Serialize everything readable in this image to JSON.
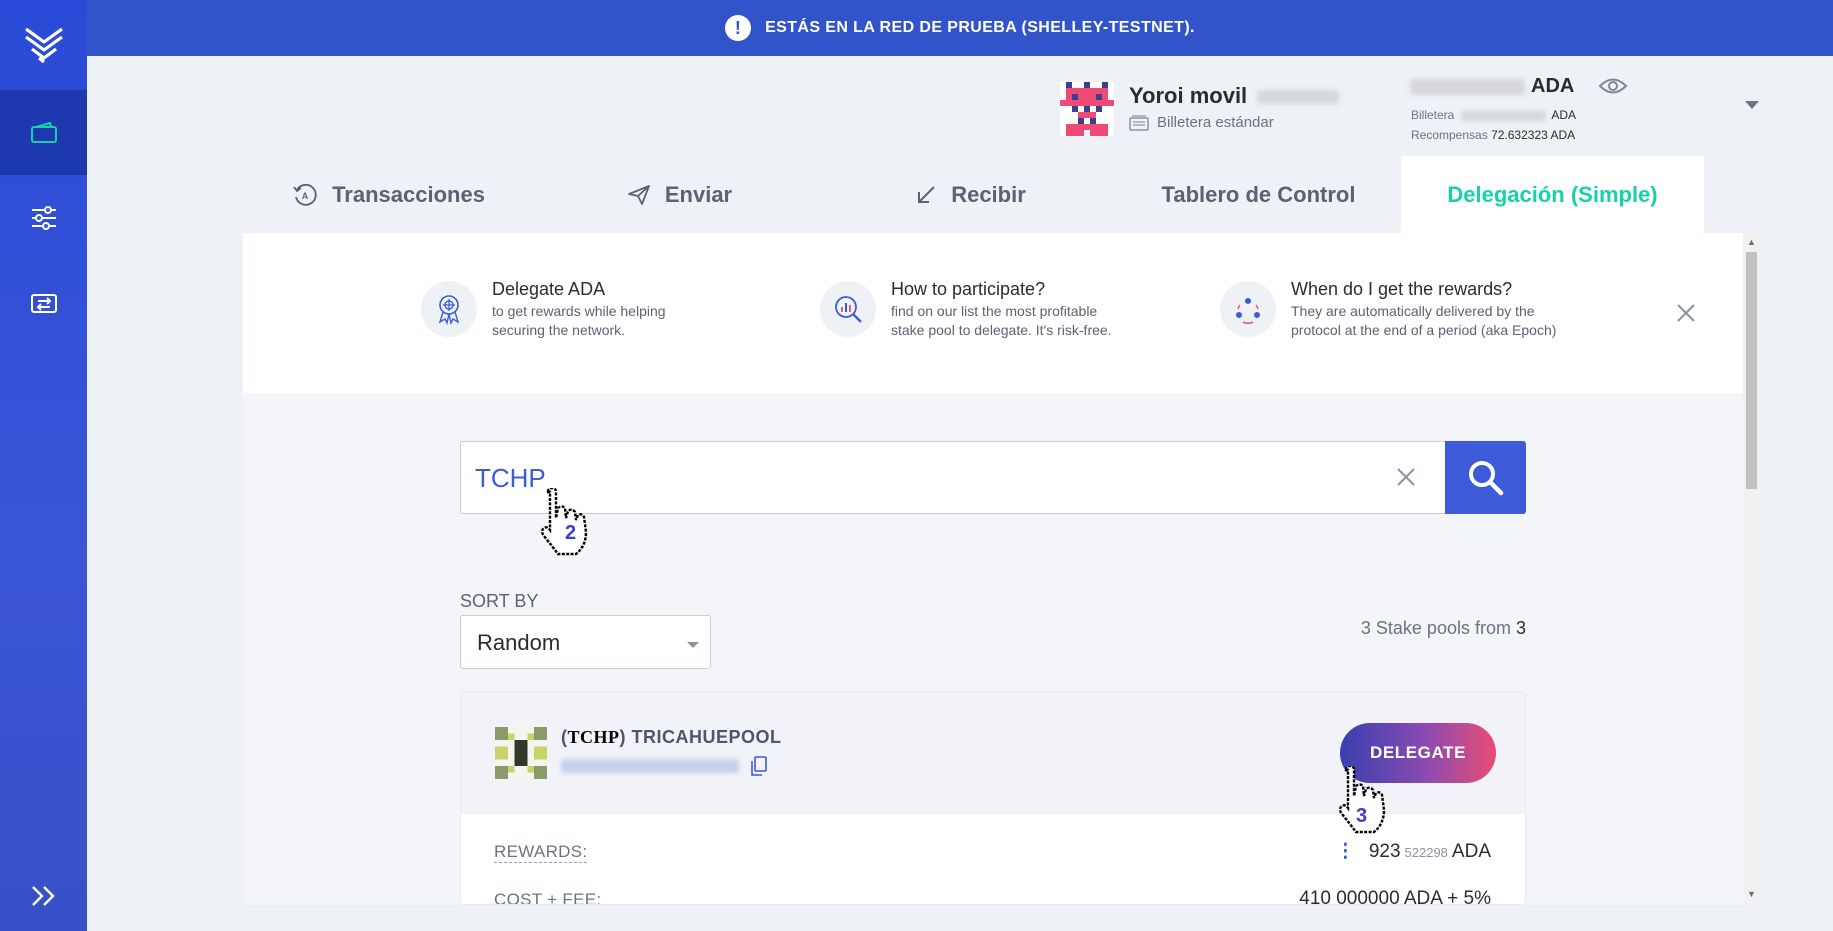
{
  "banner": {
    "text": "ESTÁS EN LA RED DE PRUEBA (SHELLEY-TESTNET)."
  },
  "sidebar": {
    "items": [
      {
        "icon": "wallet-icon",
        "active": true
      },
      {
        "icon": "settings-sliders-icon",
        "active": false
      },
      {
        "icon": "transfer-icon",
        "active": false
      }
    ]
  },
  "wallet": {
    "name": "Yoroi movil",
    "type": "Billetera estándar",
    "currency": "ADA",
    "wallet_label": "Billetera",
    "wallet_currency": "ADA",
    "rewards_label": "Recompensas",
    "rewards_value": "72.632323 ADA"
  },
  "tabs": [
    {
      "label": "Transacciones",
      "icon": "transactions-icon"
    },
    {
      "label": "Enviar",
      "icon": "send-icon"
    },
    {
      "label": "Recibir",
      "icon": "receive-icon"
    },
    {
      "label": "Tablero de Control",
      "icon": ""
    },
    {
      "label": "Delegación (Simple)",
      "icon": "",
      "active": true
    }
  ],
  "info": [
    {
      "title": "Delegate ADA",
      "desc1": "to get rewards while helping",
      "desc2": "securing the network.",
      "icon": "award-icon"
    },
    {
      "title": "How to participate?",
      "desc1": "find on our list the most profitable",
      "desc2": "stake pool to delegate. It's risk-free.",
      "icon": "magnify-chart-icon"
    },
    {
      "title": "When do I get the rewards?",
      "desc1": "They are automatically delivered by the",
      "desc2": "protocol at the end of a period (aka Epoch)",
      "icon": "people-cycle-icon"
    }
  ],
  "search": {
    "value": "TCHP"
  },
  "sort": {
    "label": "SORT BY",
    "value": "Random"
  },
  "pool_count": {
    "text": "3 Stake pools from",
    "total": "3"
  },
  "pool": {
    "ticker": "TCHP",
    "name": "TRICAHUEPOOL",
    "delegate_label": "DELEGATE",
    "rewards_label": "REWARDS:",
    "rewards_main": "923",
    "rewards_decimals": "522298",
    "rewards_unit": "ADA",
    "cost_label": "COST + FEE:",
    "cost_value": "410 000000 ADA + 5%"
  },
  "cursors": {
    "first": "2",
    "second": "3"
  },
  "colors": {
    "accent": "#3d5bd9",
    "active_tab": "#17d1aa",
    "banner": "#3154cb",
    "sidebar": "#2a4bd7"
  }
}
